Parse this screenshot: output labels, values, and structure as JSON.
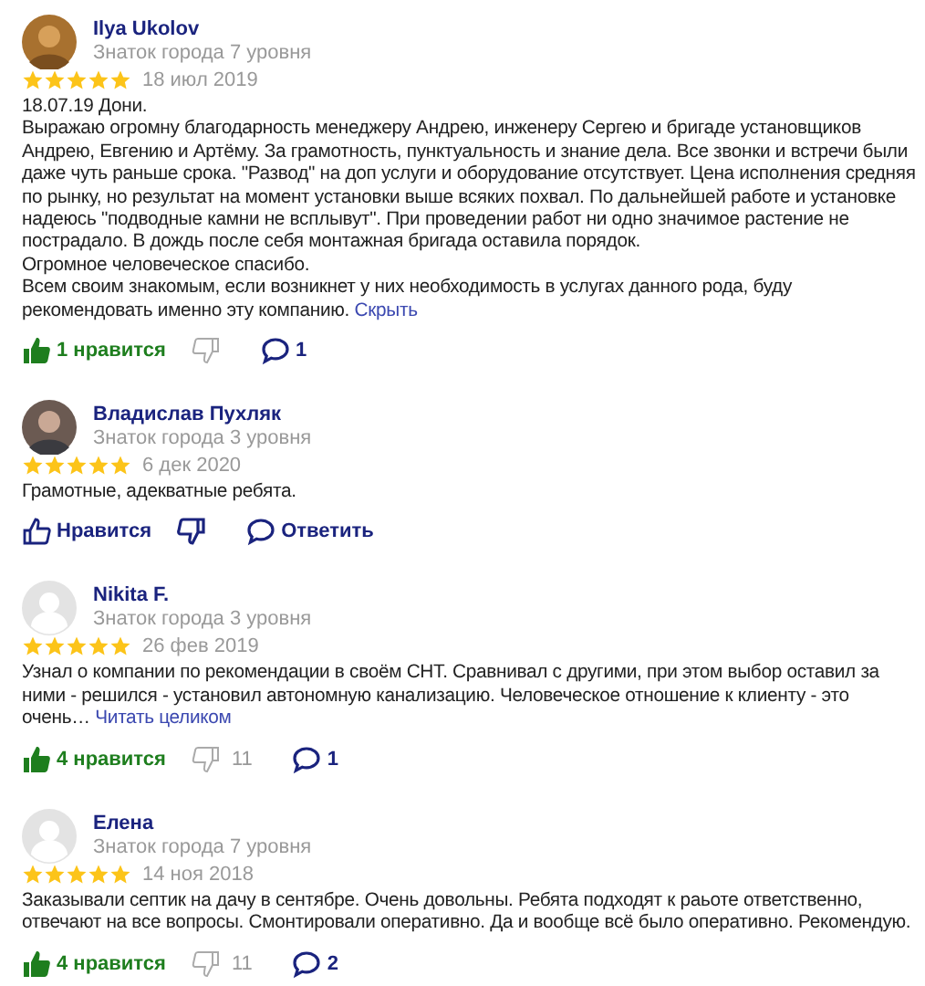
{
  "reviews": [
    {
      "name": "Ilya Ukolov",
      "level": "Знаток города 7 уровня",
      "stars": 5,
      "date": "18 июл 2019",
      "paragraphs": [
        "18.07.19 Дони.",
        "Выражаю огромну благодарность менеджеру Андрею, инженеру Сергею и бригаде установщиков Андрею, Евгению и Артёму. За грамотность, пунктуальность и знание дела. Все звонки и встречи были даже чуть раньше срока. \"Развод\" на доп услуги и оборудование отсутствует. Цена исполнения средняя по рынку, но результат на момент установки выше всяких похвал. По дальнейшей работе и установке надеюсь \"подводные камни не всплывут\". При проведении работ ни одно значимое растение не пострадало. В дождь после себя монтажная бригада оставила порядок.",
        "Огромное человеческое спасибо.",
        "Всем своим знакомым, если возникнет у них необходимость в услугах данного рода, буду рекомендовать именно эту компанию."
      ],
      "link": "Скрыть",
      "like": {
        "liked": true,
        "label": "1 нравится"
      },
      "dislike": {
        "dimmed": true
      },
      "comment": {
        "label": "1"
      }
    },
    {
      "name": "Владислав Пухляк",
      "level": "Знаток города 3 уровня",
      "stars": 5,
      "date": "6 дек 2020",
      "paragraphs": [
        "Грамотные, адекватные ребята."
      ],
      "like": {
        "liked": false,
        "label": "Нравится"
      },
      "dislike": {
        "dimmed": false
      },
      "comment": {
        "label": "Ответить"
      }
    },
    {
      "name": "Nikita F.",
      "level": "Знаток города 3 уровня",
      "avatar": {
        "kind": "placeholder"
      },
      "stars": 5,
      "date": "26 фев 2019",
      "paragraphs": [
        "Узнал о компании по рекомендации в своём СНТ. Сравнивал с другими, при этом выбор оставил за ними - решился - установил автономную канализацию. Человеческое отношение к клиенту - это очень…"
      ],
      "link": "Читать целиком",
      "like": {
        "liked": true,
        "label": "4 нравится"
      },
      "dislike": {
        "dimmed": true,
        "count": "11"
      },
      "comment": {
        "label": "1"
      }
    },
    {
      "name": "Елена",
      "level": "Знаток города 7 уровня",
      "avatar": {
        "kind": "placeholder"
      },
      "stars": 5,
      "date": "14 ноя 2018",
      "paragraphs": [
        "Заказывали септик на дачу в сентябре. Очень довольны. Ребята подходят к раьоте ответственно, отвечают на все вопросы. Смонтировали оперативно. Да и вообще всё было оперативно. Рекомендую."
      ],
      "like": {
        "liked": true,
        "label": "4 нравится"
      },
      "dislike": {
        "dimmed": true,
        "count": "11"
      },
      "comment": {
        "label": "2"
      }
    }
  ]
}
